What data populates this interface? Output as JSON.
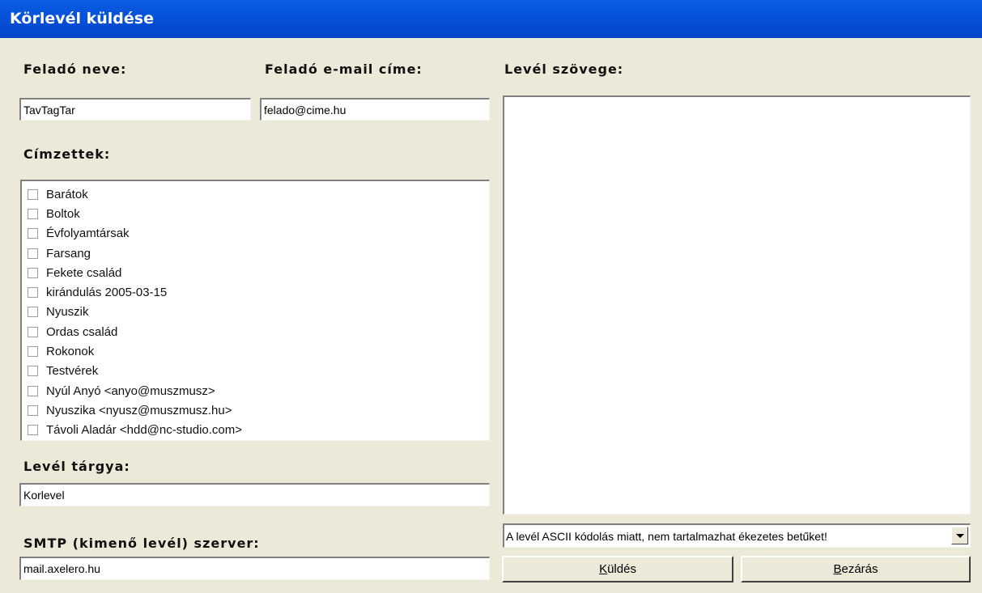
{
  "window": {
    "title": "Körlevél küldése"
  },
  "sender": {
    "name_label": "Feladó neve:",
    "name_value": "TavTagTar",
    "email_label": "Feladó e-mail címe:",
    "email_value": "felado@cime.hu"
  },
  "recipients": {
    "label": "Címzettek:",
    "items": [
      {
        "label": "Barátok",
        "checked": false
      },
      {
        "label": "Boltok",
        "checked": false
      },
      {
        "label": "Évfolyamtársak",
        "checked": false
      },
      {
        "label": "Farsang",
        "checked": false
      },
      {
        "label": "Fekete család",
        "checked": false
      },
      {
        "label": "kirándulás 2005-03-15",
        "checked": false
      },
      {
        "label": "Nyuszik",
        "checked": false
      },
      {
        "label": "Ordas család",
        "checked": false
      },
      {
        "label": "Rokonok",
        "checked": false
      },
      {
        "label": "Testvérek",
        "checked": false
      },
      {
        "label": "Nyúl Anyó <anyo@muszmusz>",
        "checked": false
      },
      {
        "label": "Nyuszika  <nyusz@muszmusz.hu>",
        "checked": false
      },
      {
        "label": "Távoli Aladár <hdd@nc-studio.com>",
        "checked": false
      }
    ]
  },
  "subject": {
    "label": "Levél tárgya:",
    "value": "Korlevel"
  },
  "smtp": {
    "label": "SMTP (kimenő levél) szerver:",
    "value": "mail.axelero.hu"
  },
  "body": {
    "label": "Levél szövege:",
    "value": ""
  },
  "encoding": {
    "selected": "A levél ASCII kódolás miatt, nem tartalmazhat ékezetes betűket!",
    "dropdown_icon": "chevron-down-icon"
  },
  "buttons": {
    "send_hotkey": "K",
    "send_rest": "üldés",
    "close_hotkey": "B",
    "close_rest": "ezárás"
  }
}
